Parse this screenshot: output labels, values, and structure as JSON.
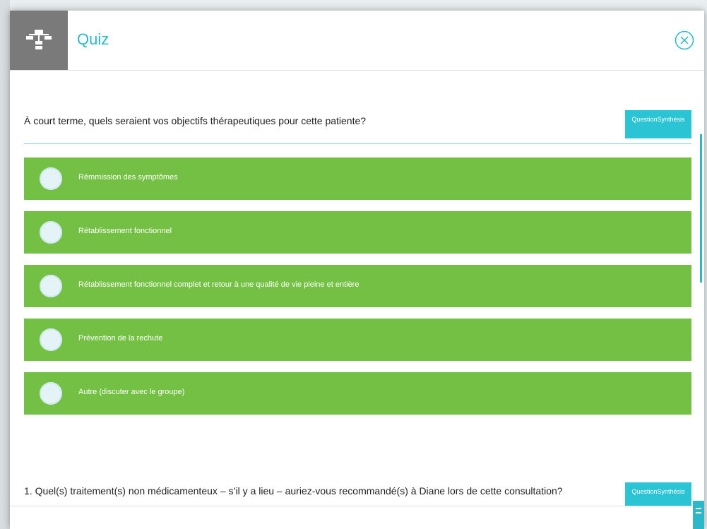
{
  "header": {
    "title": "Quiz",
    "icon": "sitemap-icon",
    "close_icon": "close-circle-icon"
  },
  "colors": {
    "accent": "#2bb9c9",
    "answer_bg": "#74c044",
    "icon_box": "#7a7a7a"
  },
  "questions": [
    {
      "text": "À court terme, quels seraient vos objectifs thérapeutiques pour cette patiente?",
      "synthesis_label": "QuestionSynthésis",
      "answers": [
        "Rémmission des symptômes",
        "Rétablissement fonctionnel",
        "Rétablissement fonctionnel complet et retour à une qualité de vie pleine et entière",
        "Prévention de la rechute",
        "Autre (discuter avec le groupe)"
      ]
    },
    {
      "text": "1. Quel(s) traitement(s) non médicamenteux – s’il y a lieu – auriez-vous recommandé(s) à Diane lors de cette consultation?",
      "synthesis_label": "QuestionSynthésis"
    }
  ]
}
